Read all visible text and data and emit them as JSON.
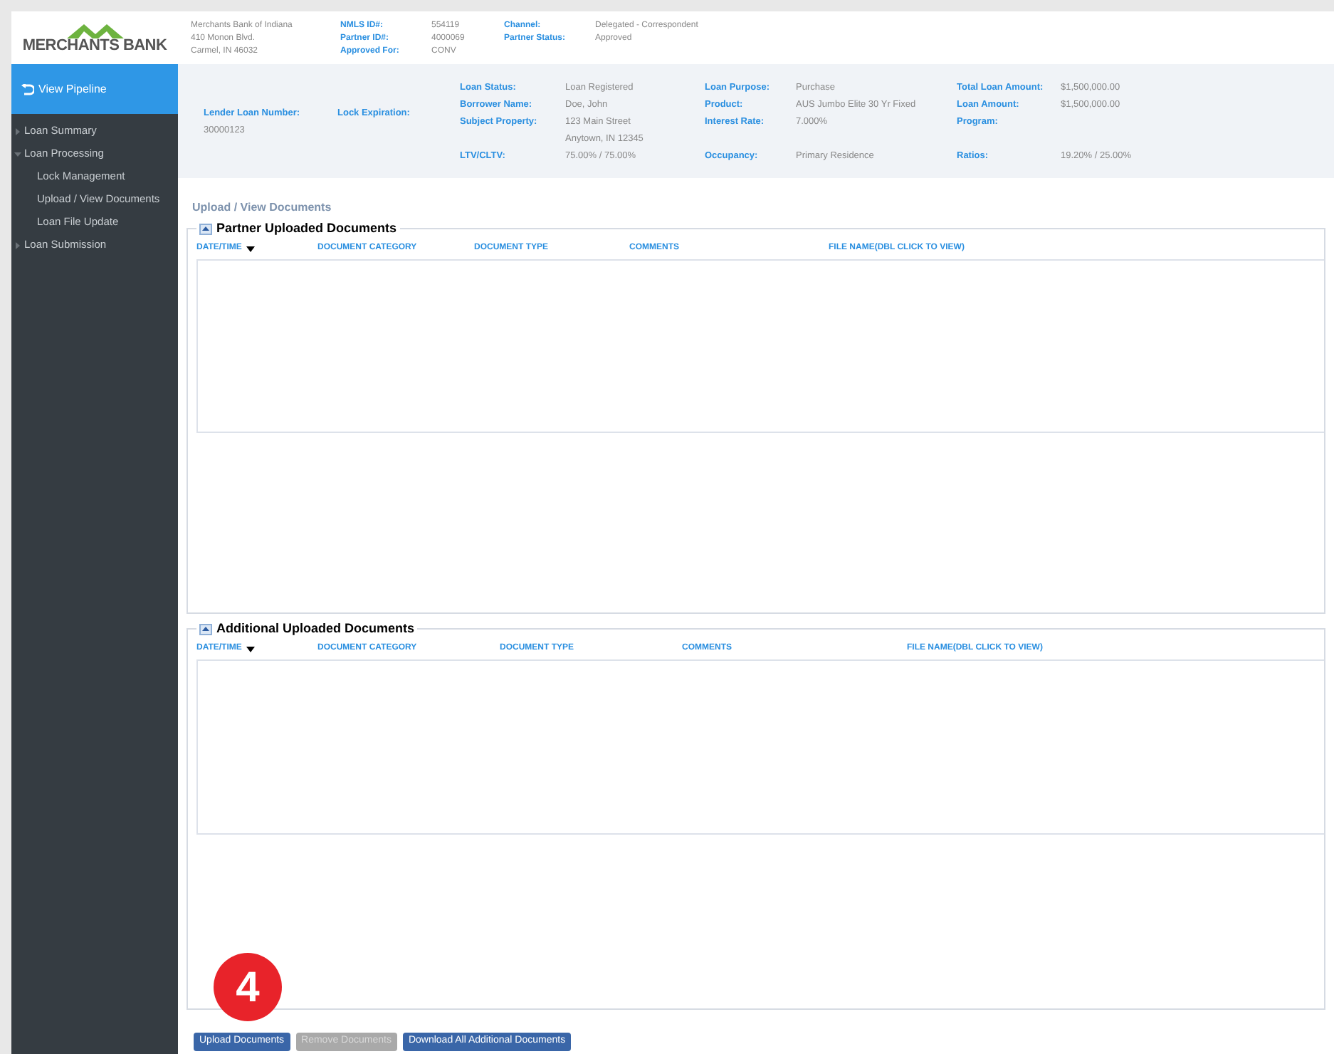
{
  "logo": {
    "name": "MERCHANTS BANK"
  },
  "bank_address": [
    "Merchants Bank of Indiana",
    "410 Monon Blvd.",
    "Carmel, IN 46032"
  ],
  "header_fields": [
    {
      "label": "NMLS ID#:",
      "value": "554119"
    },
    {
      "label": "Partner ID#:",
      "value": "4000069"
    },
    {
      "label": "Approved For:",
      "value": "CONV"
    }
  ],
  "header_fields_2": [
    {
      "label": "Channel:",
      "value": "Delegated - Correspondent"
    },
    {
      "label": "Partner Status:",
      "value": "Approved"
    }
  ],
  "sidebar": {
    "back_link": "View Pipeline",
    "items": [
      {
        "label": "Loan Summary",
        "expanded": false
      },
      {
        "label": "Loan Processing",
        "expanded": true,
        "children": [
          {
            "label": "Lock Management"
          },
          {
            "label": "Upload / View Documents"
          },
          {
            "label": "Loan File Update"
          }
        ]
      },
      {
        "label": "Loan Submission",
        "expanded": false
      }
    ]
  },
  "loan_info": {
    "lender_loan_number": {
      "label": "Lender Loan Number:",
      "value": "30000123"
    },
    "lock_expiration": {
      "label": "Lock Expiration:"
    },
    "columns": [
      [
        {
          "label": "Loan Status:",
          "value": "Loan Registered"
        },
        {
          "label": "Borrower Name:",
          "value": "Doe, John"
        },
        {
          "label": "Subject Property:",
          "value": "123 Main Street",
          "value_2": "Anytown, IN 12345"
        },
        {
          "label": "LTV/CLTV:",
          "value": "75.00% / 75.00%"
        }
      ],
      [
        {
          "label": "Loan Purpose:",
          "value": "Purchase"
        },
        {
          "label": "Product:",
          "value": "AUS Jumbo Elite 30 Yr Fixed"
        },
        {
          "label": "Interest Rate:",
          "value": "7.000%"
        },
        {
          "label": "Occupancy:",
          "value": "Primary Residence"
        }
      ],
      [
        {
          "label": "Total Loan Amount:",
          "value": "$1,500,000.00"
        },
        {
          "label": "Loan Amount:",
          "value": "$1,500,000.00"
        },
        {
          "label": "Program:"
        },
        {
          "label": "Ratios:",
          "value": "19.20% / 25.00%"
        }
      ]
    ]
  },
  "page_title": "Upload / View Documents",
  "sections": [
    {
      "title": "Partner Uploaded Documents",
      "expanded": true,
      "columns": [
        "DATE/TIME",
        "DOCUMENT CATEGORY",
        "DOCUMENT TYPE",
        "COMMENTS",
        "FILE NAME(DBL CLICK TO VIEW)"
      ]
    },
    {
      "title": "Additional Uploaded Documents",
      "expanded": true,
      "columns": [
        "DATE/TIME",
        "DOCUMENT CATEGORY",
        "DOCUMENT TYPE",
        "COMMENTS",
        "FILE NAME(DBL CLICK TO VIEW)"
      ]
    }
  ],
  "step_badge": "4",
  "buttons": [
    {
      "label": "Upload Documents",
      "disabled": false
    },
    {
      "label": "Remove Documents",
      "disabled": true
    },
    {
      "label": "Download All Additional Documents",
      "disabled": false
    }
  ]
}
